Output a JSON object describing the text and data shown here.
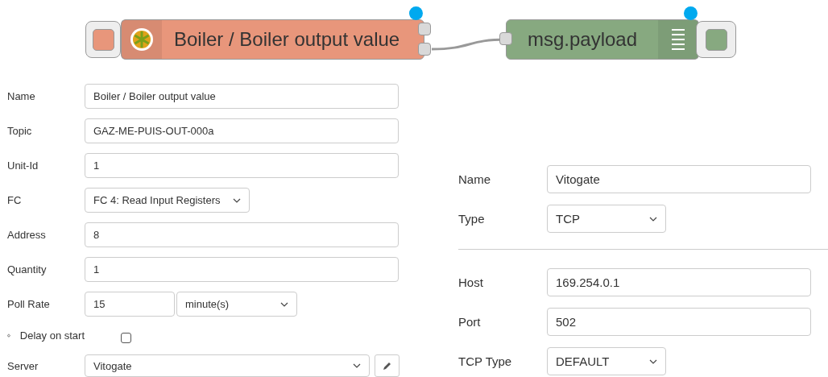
{
  "flow": {
    "nodes": [
      {
        "kind": "modbus-read",
        "label": "Boiler / Boiler output value",
        "color": "#e8967b",
        "changed": true
      },
      {
        "kind": "debug",
        "label": "msg.payload",
        "color": "#87a980",
        "changed": true
      }
    ]
  },
  "node_form": {
    "fields": [
      {
        "kind": "text",
        "label": "Name",
        "value": "Boiler / Boiler output value"
      },
      {
        "kind": "text",
        "label": "Topic",
        "value": "GAZ-ME-PUIS-OUT-000a"
      },
      {
        "kind": "text",
        "label": "Unit-Id",
        "value": "1"
      },
      {
        "kind": "select",
        "label": "FC",
        "value": "FC 4: Read Input Registers"
      },
      {
        "kind": "text",
        "label": "Address",
        "value": "8"
      },
      {
        "kind": "text",
        "label": "Quantity",
        "value": "1"
      },
      {
        "kind": "rate",
        "label": "Poll Rate",
        "value": "15",
        "unit": "minute(s)"
      },
      {
        "kind": "checkbox",
        "label": "Delay on start",
        "checked": false
      },
      {
        "kind": "server",
        "label": "Server",
        "value": "Vitogate"
      }
    ]
  },
  "server_form": {
    "sections": [
      [
        {
          "kind": "text",
          "label": "Name",
          "value": "Vitogate"
        },
        {
          "kind": "select",
          "label": "Type",
          "value": "TCP"
        }
      ],
      [
        {
          "kind": "text",
          "label": "Host",
          "value": "169.254.0.1"
        },
        {
          "kind": "text",
          "label": "Port",
          "value": "502"
        },
        {
          "kind": "select",
          "label": "TCP Type",
          "value": "DEFAULT"
        }
      ]
    ]
  }
}
